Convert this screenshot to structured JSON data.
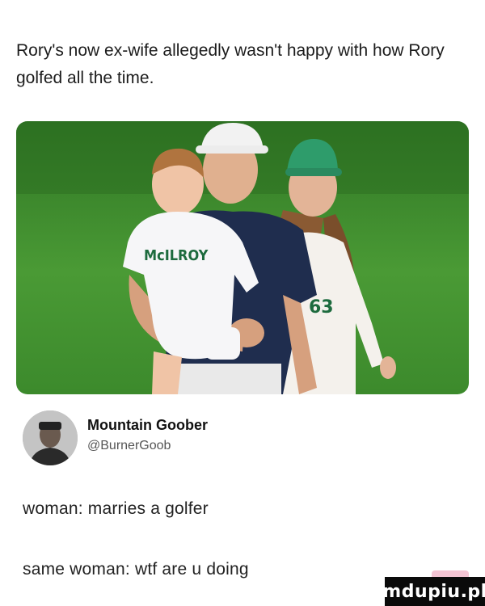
{
  "post": {
    "headline": "Rory's now ex-wife allegedly wasn't happy with how Rory golfed all the time."
  },
  "photo": {
    "jersey_text": "McILROY",
    "caddie_number": "63",
    "colors": {
      "grass": "#3f8a2f",
      "shirt": "#1f2d4e",
      "caddie_cap": "#2e9c6b"
    }
  },
  "tweet": {
    "author_name": "Mountain Goober",
    "author_handle": "@BurnerGoob",
    "line1": "woman: marries a golfer",
    "line2": "same woman: wtf are u doing"
  },
  "watermark": {
    "label": "mdupiu.pl"
  }
}
